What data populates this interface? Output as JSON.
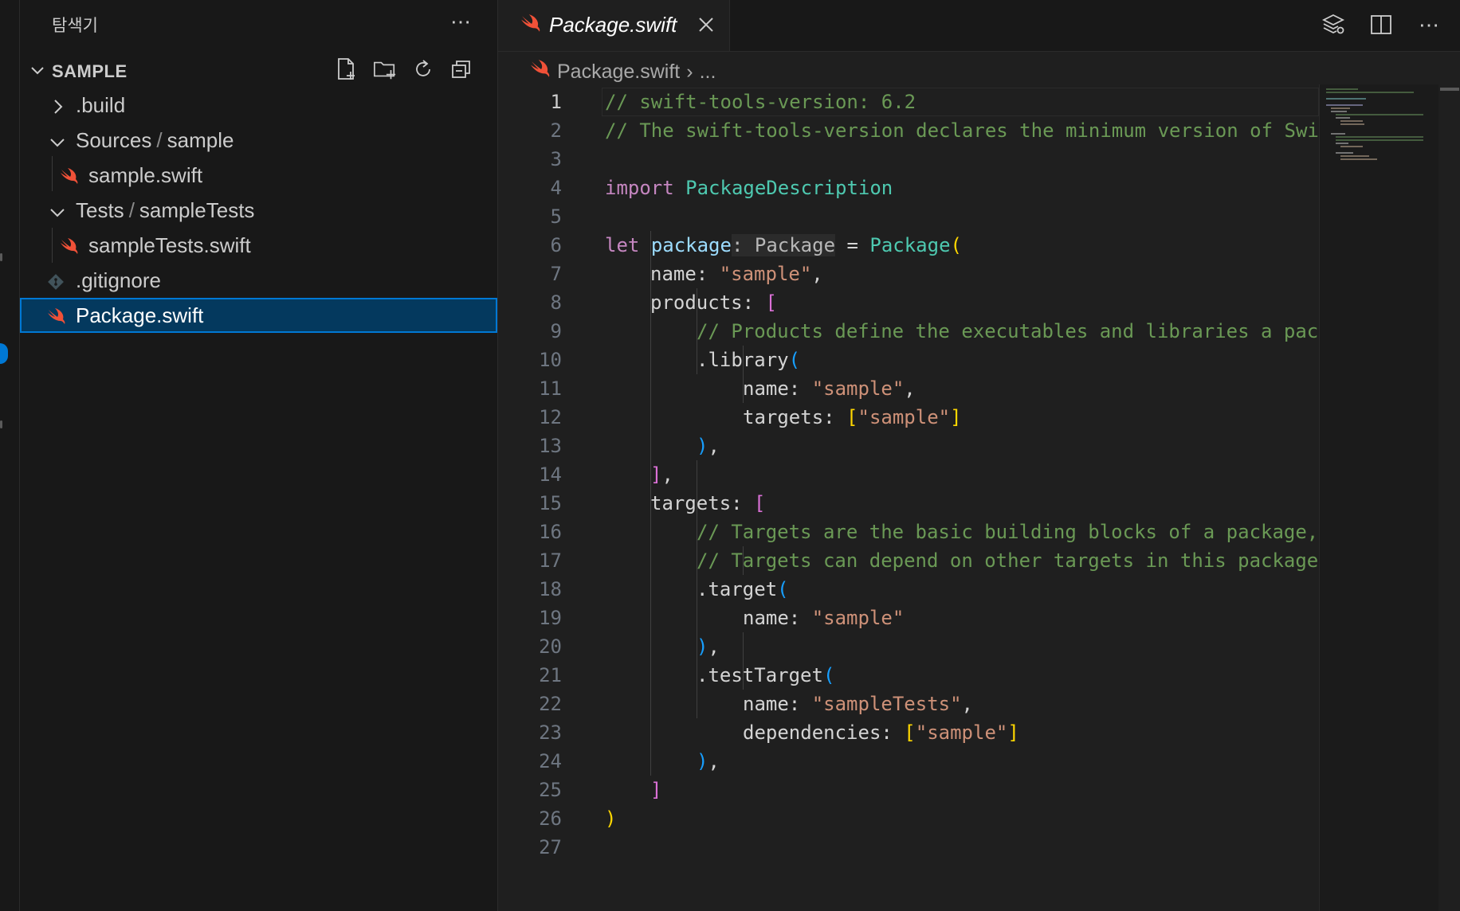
{
  "sidebar": {
    "title": "탐색기",
    "section_title": "SAMPLE",
    "more_label": "⋯",
    "tree": [
      {
        "label": ".build",
        "icon": "chevron-right-icon"
      },
      {
        "label_a": "Sources",
        "label_sep": "/",
        "label_b": "sample",
        "icon": "chevron-down-icon"
      },
      {
        "label": "sample.swift",
        "icon": "swift-icon"
      },
      {
        "label_a": "Tests",
        "label_sep": "/",
        "label_b": "sampleTests",
        "icon": "chevron-down-icon"
      },
      {
        "label": "sampleTests.swift",
        "icon": "swift-icon"
      },
      {
        "label": ".gitignore",
        "icon": "git-icon"
      },
      {
        "label": "Package.swift",
        "icon": "swift-icon",
        "selected": true
      }
    ]
  },
  "editor": {
    "tab": {
      "label": "Package.swift"
    },
    "breadcrumb": {
      "file": "Package.swift",
      "sep": "›",
      "more": "..."
    },
    "more_label": "⋯",
    "line_numbers": [
      "1",
      "2",
      "3",
      "4",
      "5",
      "6",
      "7",
      "8",
      "9",
      "10",
      "11",
      "12",
      "13",
      "14",
      "15",
      "16",
      "17",
      "18",
      "19",
      "20",
      "21",
      "22",
      "23",
      "24",
      "25",
      "26",
      "27"
    ]
  },
  "code": {
    "l1": "// swift-tools-version: 6.2",
    "l2": "// The swift-tools-version declares the minimum version of Swi",
    "l4_kw": "import",
    "l4_mod": "PackageDescription",
    "l6_kw": "let",
    "l6_var": "package",
    "l6_hint": ": Package",
    "l6_eq": " = ",
    "l6_type": "Package",
    "l6_p": "(",
    "l7_key": "name: ",
    "l7_str": "\"sample\"",
    "l7_c": ",",
    "l8_key": "products: ",
    "l8_p": "[",
    "l9": "// Products define the executables and libraries a pac",
    "l10_fn": ".library",
    "l10_p": "(",
    "l11_key": "name: ",
    "l11_str": "\"sample\"",
    "l11_c": ",",
    "l12_key": "targets: ",
    "l12_p1": "[",
    "l12_str": "\"sample\"",
    "l12_p2": "]",
    "l13_p": ")",
    "l13_c": ",",
    "l14_p": "]",
    "l14_c": ",",
    "l15_key": "targets: ",
    "l15_p": "[",
    "l16": "// Targets are the basic building blocks of a package,",
    "l17": "// Targets can depend on other targets in this package",
    "l18_fn": ".target",
    "l18_p": "(",
    "l19_key": "name: ",
    "l19_str": "\"sample\"",
    "l20_p": ")",
    "l20_c": ",",
    "l21_fn": ".testTarget",
    "l21_p": "(",
    "l22_key": "name: ",
    "l22_str": "\"sampleTests\"",
    "l22_c": ",",
    "l23_key": "dependencies: ",
    "l23_p1": "[",
    "l23_str": "\"sample\"",
    "l23_p2": "]",
    "l24_p": ")",
    "l24_c": ",",
    "l25_p": "]",
    "l26_p": ")"
  },
  "colors": {
    "selection": "#04395e",
    "accent": "#0078d4",
    "swift": "#f05138",
    "comment": "#6a9955",
    "keyword": "#c586c0",
    "type": "#4ec9b0",
    "string": "#ce9178"
  }
}
